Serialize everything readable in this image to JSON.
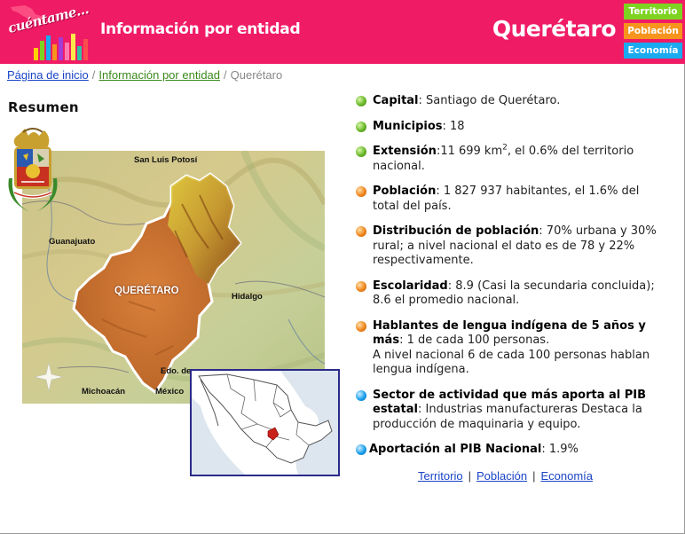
{
  "header": {
    "logo_text": "cuéntame...",
    "title": "Información por entidad",
    "state": "Querétaro",
    "nav": [
      {
        "label": "Territorio",
        "color": "#7ed321"
      },
      {
        "label": "Población",
        "color": "#f7941d"
      },
      {
        "label": "Economía",
        "color": "#1aaaf0"
      }
    ]
  },
  "breadcrumb": {
    "home": "Página de inicio",
    "sep1": "/",
    "info": "Información por entidad",
    "sep2": "/",
    "current": "Querétaro"
  },
  "summary": {
    "heading": "Resumen",
    "map_labels": {
      "north": "San Luis Potosí",
      "west": "Guanajuato",
      "state": "QUERÉTARO",
      "east": "Hidalgo",
      "south_east_1": "Edo. de",
      "south_east_2": "México",
      "south_west": "Michoacán"
    }
  },
  "info": {
    "capital_label": "Capital",
    "capital_value": ": Santiago de Querétaro.",
    "municipios_label": "Municipios",
    "municipios_value": ": 18",
    "extension_label": "Extensión",
    "extension_value_a": ":11 699 km",
    "extension_sup": "2",
    "extension_value_b": ", el 0.6% del territorio nacional.",
    "poblacion_label": "Población",
    "poblacion_value": ": 1 827 937 habitantes, el 1.6% del total del país.",
    "distribucion_label": "Distribución de población",
    "distribucion_value": ": 70% urbana y 30% rural; a nivel nacional el dato es de 78 y 22% respectivamente.",
    "escolaridad_label": "Escolaridad",
    "escolaridad_value": ": 8.9 (Casi la secundaria concluida); 8.6 el promedio nacional.",
    "hablantes_label": "Hablantes de lengua indígena de 5 años y más",
    "hablantes_value": ": 1 de cada 100 personas.",
    "hablantes_value2": "A nivel nacional 6 de cada 100 personas hablan lengua indígena.",
    "sector_label": "Sector de actividad que más aporta al PIB estatal",
    "sector_value": ": Industrias manufactureras Destaca la producción de maquinaria y equipo.",
    "aportacion_label": "Aportación al PIB Nacional",
    "aportacion_value": ": 1.9%"
  },
  "bottom_links": {
    "territorio": "Territorio",
    "sep1": "|",
    "poblacion": "Población",
    "sep2": "|",
    "economia": "Economía"
  }
}
